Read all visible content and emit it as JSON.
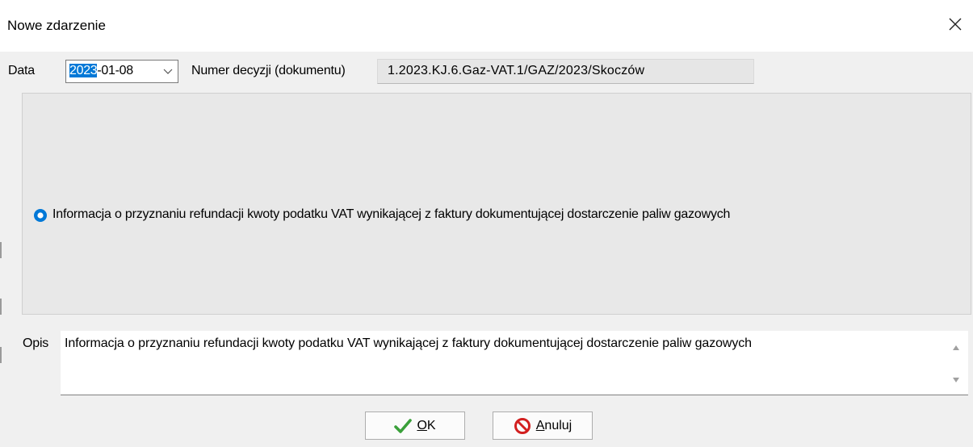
{
  "window": {
    "title": "Nowe zdarzenie",
    "close_icon": "close-icon"
  },
  "form": {
    "date_label": "Data",
    "date_value_selected": "2023",
    "date_value_rest": "-01-08",
    "decision_number_label": "Numer decyzji (dokumentu)",
    "decision_number_value": "1.2023.KJ.6.Gaz-VAT.1/GAZ/2023/Skoczów"
  },
  "group": {
    "radio_label": "Informacja o przyznaniu refundacji kwoty podatku VAT wynikającej z faktury dokumentującej dostarczenie paliw gazowych",
    "radio_selected": true
  },
  "description": {
    "label": "Opis",
    "value": "Informacja o przyznaniu refundacji kwoty podatku VAT wynikającej z faktury dokumentującej dostarczenie paliw gazowych"
  },
  "buttons": {
    "ok_underlined": "O",
    "ok_rest": "K",
    "cancel_underlined": "A",
    "cancel_rest": "nuluj"
  },
  "colors": {
    "accent": "#0078d7",
    "ok_check": "#3aa03a",
    "cancel_icon": "#d21f1f"
  }
}
